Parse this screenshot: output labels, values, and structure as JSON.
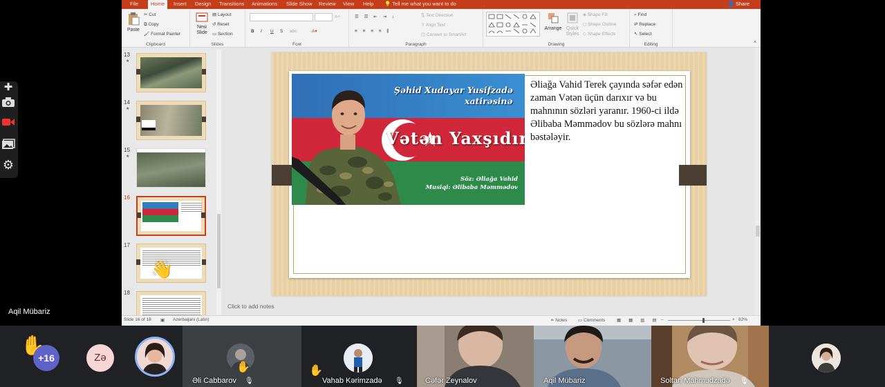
{
  "powerpoint": {
    "tabs": [
      "File",
      "Home",
      "Insert",
      "Design",
      "Transitions",
      "Animations",
      "Slide Show",
      "Review",
      "View",
      "Help"
    ],
    "active_tab": "Home",
    "tell_me": "Tell me what you want to do",
    "share": "Share",
    "ribbon": {
      "clipboard": {
        "paste": "Paste",
        "cut": "Cut",
        "copy": "Copy",
        "format_painter": "Format Painter",
        "label": "Clipboard"
      },
      "slides": {
        "new_slide": "New Slide",
        "layout": "Layout",
        "reset": "Reset",
        "section": "Section",
        "label": "Slides"
      },
      "font": {
        "label": "Font",
        "bold": "B",
        "italic": "I",
        "underline": "U",
        "strike": "S",
        "shadow": "abc"
      },
      "paragraph": {
        "text_direction": "Text Direction",
        "align_text": "Align Text",
        "convert_smartart": "Convert to SmartArt",
        "label": "Paragraph"
      },
      "drawing": {
        "arrange": "Arrange",
        "quick_styles": "Quick Styles",
        "shape_fill": "Shape Fill",
        "shape_outline": "Shape Outline",
        "shape_effects": "Shape Effects",
        "label": "Drawing"
      },
      "editing": {
        "find": "Find",
        "replace": "Replace",
        "select": "Select",
        "label": "Editing"
      }
    },
    "thumbnails": [
      {
        "num": "13",
        "star": "★"
      },
      {
        "num": "14",
        "star": "★"
      },
      {
        "num": "15",
        "star": "★"
      },
      {
        "num": "16",
        "star": ""
      },
      {
        "num": "17",
        "star": ""
      },
      {
        "num": "18",
        "star": ""
      }
    ],
    "slide": {
      "poster": {
        "line1": "Şəhid Xudayar Yusifzadə",
        "line2": "xatirəsinə",
        "title": "Vətən Yaxşıdır",
        "credit1": "Söz: Əliağa Vahid",
        "credit2": "Musiqi: Əlibaba Məmmədov"
      },
      "text": "Əliağa Vahid Terek çayında səfər edən zaman Vətən üçün darıxır və bu mahnının sözləri yaranır. 1960-ci ildə  Əlibaba Məmmədov bu sözlərə mahnı bəstələyir."
    },
    "notes_placeholder": "Click to add notes",
    "status": {
      "slide_info": "Slide 16 of 18",
      "language": "Azerbaijani (Latin)",
      "notes": "Notes",
      "comments": "Comments",
      "zoom": "82%"
    }
  },
  "meet": {
    "presenter_name": "Aqil Mübariz",
    "more_count": "+16",
    "avatar_initials": "Zə",
    "participants": [
      {
        "name": "Əli Cabbarov"
      },
      {
        "name": "Vahab Kərimzadə"
      },
      {
        "name": "Cəfər Zeynalov"
      },
      {
        "name": "Aqil Mübariz"
      },
      {
        "name": "Soltan Mahmudzadə"
      }
    ]
  },
  "colors": {
    "ppt_accent": "#c43e1c",
    "flag_blue": "#2d7fc1",
    "flag_red": "#d0283a",
    "flag_green": "#2e8a4a",
    "meet_purple": "#5f63c7"
  }
}
